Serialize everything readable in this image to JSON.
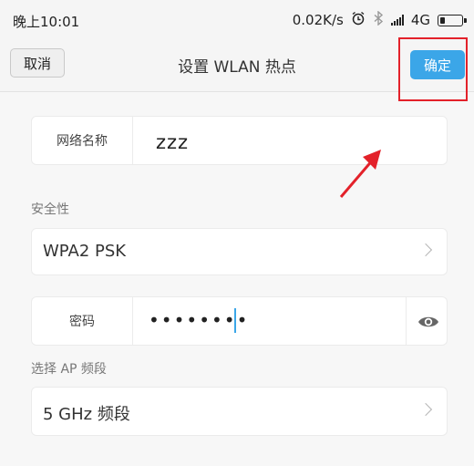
{
  "status_bar": {
    "time": "晚上10:01",
    "speed": "0.02K/s",
    "network": "4G",
    "icons": [
      "alarm-icon",
      "bluetooth-icon",
      "signal-icon",
      "battery-icon"
    ]
  },
  "header": {
    "cancel_label": "取消",
    "title": "设置 WLAN 热点",
    "confirm_label": "确定"
  },
  "form": {
    "ssid_label": "网络名称",
    "ssid_value": "zzz",
    "security_section_label": "安全性",
    "security_value": "WPA2 PSK",
    "password_label": "密码",
    "password_value": "••••••••",
    "band_section_label": "选择 AP 频段",
    "band_value": "5 GHz 频段"
  },
  "colors": {
    "accent": "#3ba6e8",
    "annotation": "#e3212a"
  }
}
